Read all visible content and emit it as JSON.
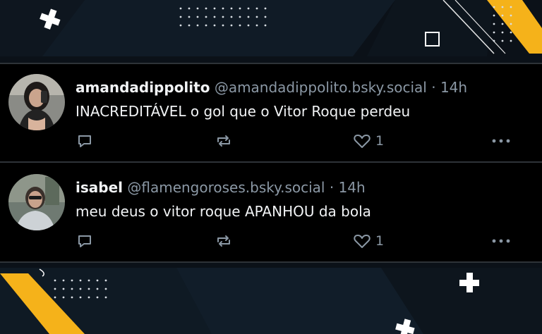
{
  "posts": [
    {
      "display_name": "amandadippolito",
      "handle": "@amandadippolito.bsky.social",
      "separator": "·",
      "time": "14h",
      "text": "INACREDITÁVEL o gol que o Vitor Roque perdeu",
      "likes": "1"
    },
    {
      "display_name": "isabel",
      "handle": "@flamengoroses.bsky.social",
      "separator": "·",
      "time": "14h",
      "text": "meu deus o vitor roque APANHOU da bola",
      "likes": "1"
    }
  ],
  "icons": {
    "reply": "reply-icon",
    "repost": "repost-icon",
    "like": "heart-icon",
    "more": "more-icon"
  },
  "colors": {
    "background": "#0b1118",
    "card": "#000000",
    "accent": "#f5b21a",
    "muted_text": "#8b98a5",
    "text": "#f1f3f5"
  }
}
